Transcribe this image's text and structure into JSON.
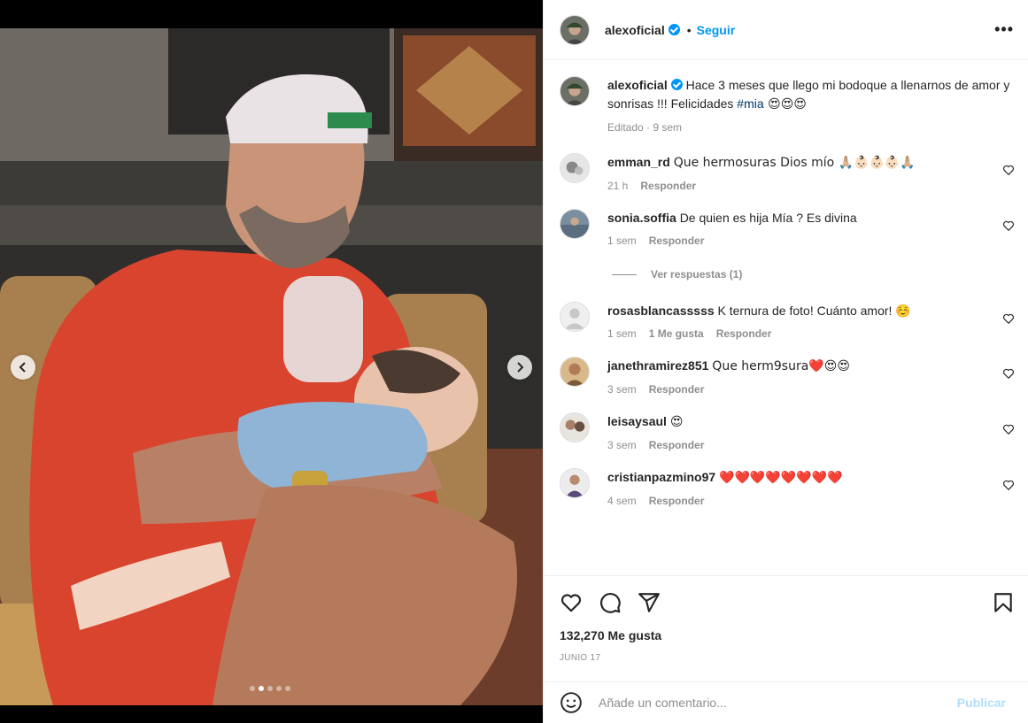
{
  "post": {
    "author": "alexoficial",
    "follow_label": "Seguir",
    "bullet": "•",
    "more_label": "•••",
    "caption": {
      "user": "alexoficial",
      "text": "Hace 3 meses que llego mi bodoque a llenarnos de amor y sonrisas !!! Felicidades ",
      "hashtag": "#mia",
      "emoji": " 😍😍😍",
      "meta": "Editado · 9 sem"
    },
    "comments": [
      {
        "user": "emman_rd",
        "text": "Que hermosuras Dios mío 🙏🏼👶🏻👶🏻👶🏻🙏🏼",
        "time": "21 h",
        "likes": "",
        "reply": "Responder"
      },
      {
        "user": "sonia.soffia",
        "text": "De quien es hija Mía ? Es divina",
        "time": "1 sem",
        "likes": "",
        "reply": "Responder"
      },
      {
        "user": "rosasblancasssss",
        "text": "K ternura de foto! Cuánto amor! ☺️",
        "time": "1 sem",
        "likes": "1 Me gusta",
        "reply": "Responder"
      },
      {
        "user": "janethramirez851",
        "text": "Que herm9sura❤️😍😍",
        "time": "3 sem",
        "likes": "",
        "reply": "Responder"
      },
      {
        "user": "leisaysaul",
        "text": "😍",
        "time": "3 sem",
        "likes": "",
        "reply": "Responder"
      },
      {
        "user": "cristianpazmino97",
        "text": "❤️❤️❤️❤️❤️❤️❤️❤️",
        "time": "4 sem",
        "likes": "",
        "reply": "Responder"
      }
    ],
    "view_replies": "Ver respuestas (1)",
    "likes_count": "132,270 Me gusta",
    "date": "JUNIO 17",
    "comment_placeholder": "Añade un comentario...",
    "publish_label": "Publicar"
  },
  "icons": {
    "prev": "chevron-left-icon",
    "next": "chevron-right-icon",
    "like": "heart-icon",
    "comment": "comment-icon",
    "share": "send-icon",
    "save": "bookmark-icon",
    "emoji": "smiley-icon"
  },
  "carousel": {
    "total_slides": 5,
    "active_slide": 2
  },
  "colors": {
    "accent": "#0095f6",
    "hashtag": "#00376b",
    "muted": "#8e8e8e",
    "publish_disabled": "#b2dffc"
  }
}
